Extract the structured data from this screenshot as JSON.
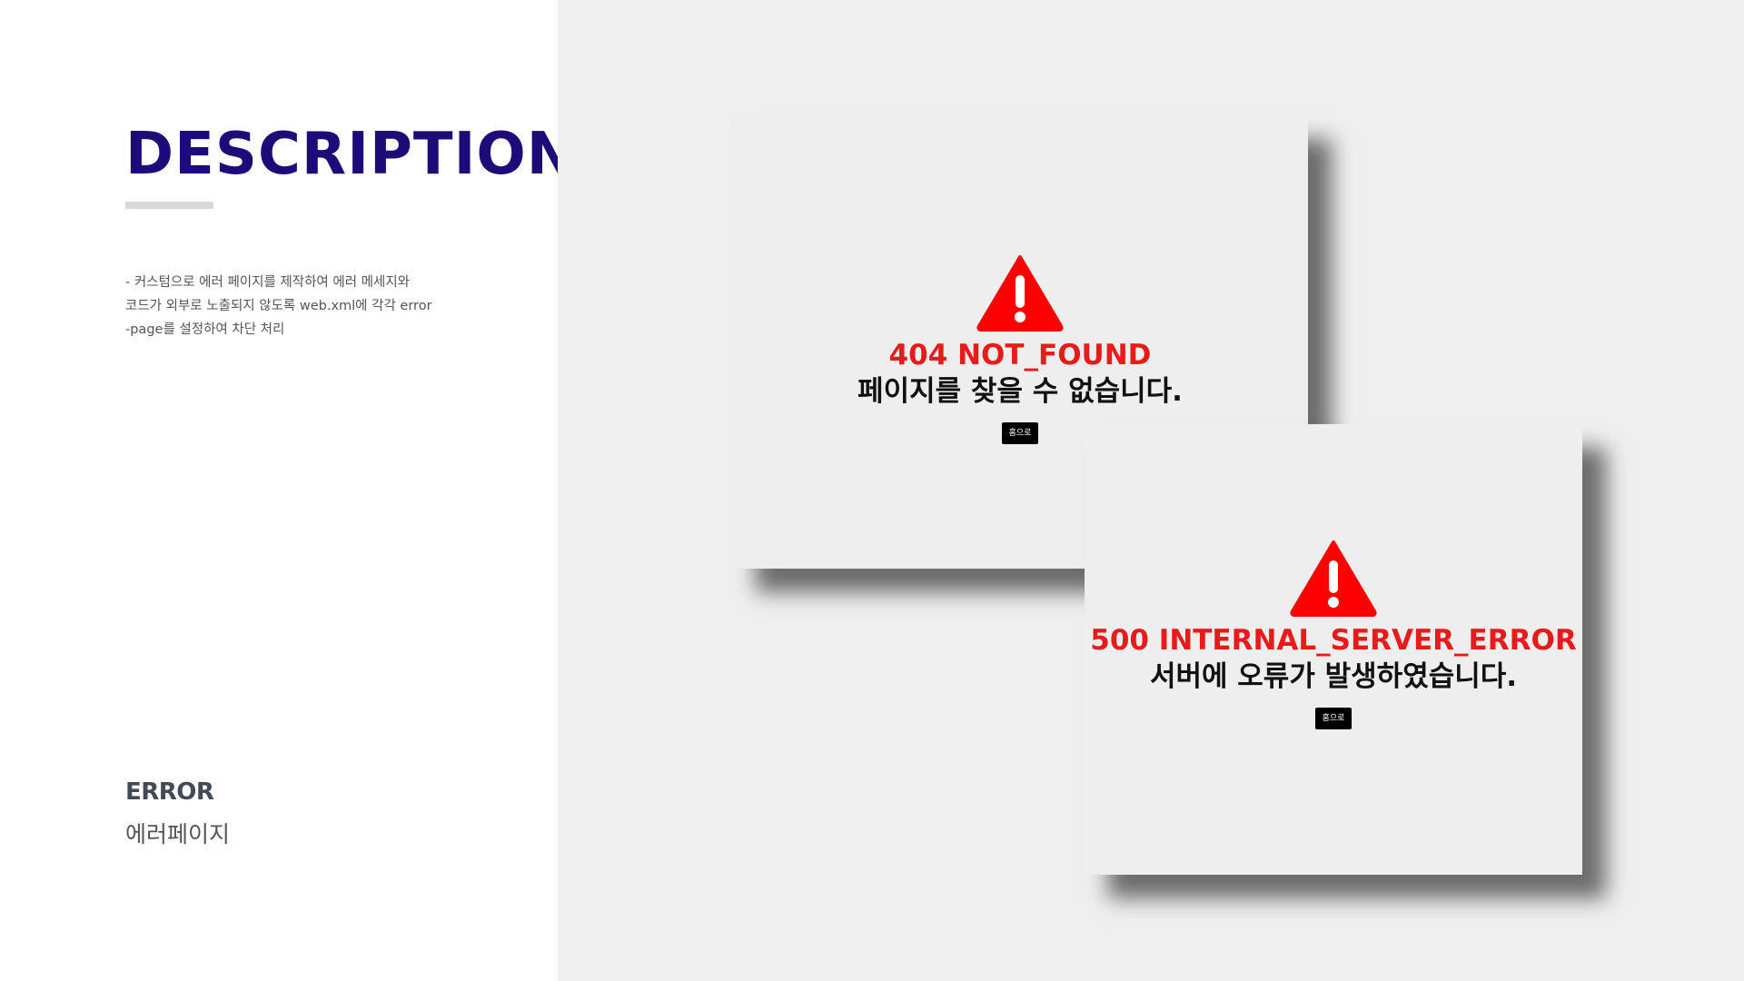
{
  "left": {
    "title": "DESCRIPTION",
    "description_lines": [
      "- 커스텀으로 에러 페이지를 제작하여 에러 메세지와",
      "코드가 외부로 노출되지 않도록 web.xml에 각각 error",
      "-page를 설정하여 차단 처리"
    ],
    "section_label": "ERROR",
    "section_sub": "에러페이지"
  },
  "screenshots": {
    "not_found": {
      "icon": "warning-triangle-icon",
      "code": "404 NOT_FOUND",
      "message": "페이지를 찾을 수 없습니다.",
      "button_label": "홈으로"
    },
    "server_error": {
      "icon": "warning-triangle-icon",
      "code": "500 INTERNAL_SERVER_ERROR",
      "message": "서버에 오류가 발생하였습니다.",
      "button_label": "홈으로"
    }
  },
  "colors": {
    "title": "#1f0a7a",
    "error_red": "#e81b1b",
    "panel_bg": "#efeff0"
  }
}
